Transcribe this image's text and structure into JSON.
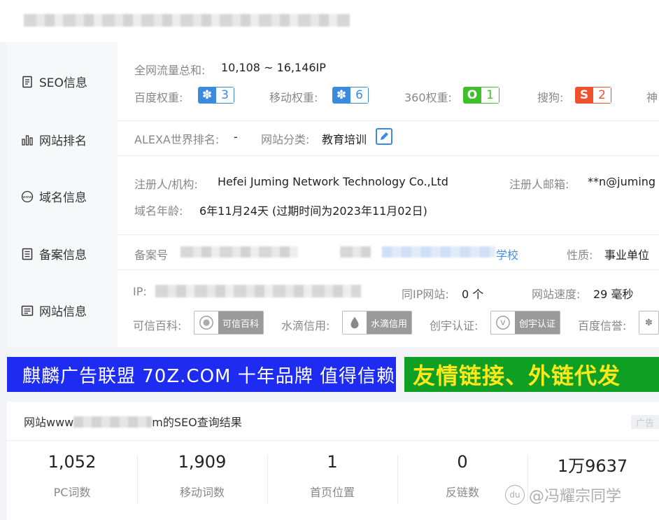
{
  "sidebar": {
    "items": [
      {
        "label": "SEO信息",
        "icon": "document-icon"
      },
      {
        "label": "网站排名",
        "icon": "bar-chart-icon"
      },
      {
        "label": "域名信息",
        "icon": "www-icon"
      },
      {
        "label": "备案信息",
        "icon": "record-icon"
      },
      {
        "label": "网站信息",
        "icon": "list-icon"
      }
    ]
  },
  "seo": {
    "traffic_label": "全网流量总和:",
    "traffic_value": "10,108 ~ 16,146IP",
    "baidu_label": "百度权重:",
    "baidu_value": "3",
    "mobile_label": "移动权重:",
    "mobile_value": "6",
    "s360_label": "360权重:",
    "s360_value": "1",
    "sogou_label": "搜狗:",
    "sogou_value": "2",
    "shenma_label": "神"
  },
  "rank": {
    "alexa_label": "ALEXA世界排名:",
    "alexa_value": "-",
    "category_label": "网站分类:",
    "category_value": "教育培训"
  },
  "domain": {
    "registrant_label": "注册人/机构:",
    "registrant_value": "Hefei Juming Network Technology Co.,Ltd",
    "email_label": "注册人邮箱:",
    "email_value": "**n@juming",
    "age_label": "域名年龄:",
    "age_value": "6年11月24天 (过期时间为2023年11月02日)"
  },
  "record": {
    "number_label": "备案号",
    "school_suffix": "学校",
    "nature_label": "性质:",
    "nature_value": "事业单位"
  },
  "site": {
    "ip_label": "IP:",
    "same_ip_label": "同IP网站:",
    "same_ip_value": "0 个",
    "speed_label": "网站速度:",
    "speed_value": "29 毫秒",
    "kexin_label": "可信百科:",
    "kexin_badge": "可信百科",
    "shuidi_label": "水滴信用:",
    "shuidi_badge": "水滴信用",
    "chuangyu_label": "创宇认证:",
    "chuangyu_badge": "创宇认证",
    "baidu_xinyu_label": "百度信誉:"
  },
  "banners": {
    "left": "麒麟广告联盟 70Z.COM 十年品牌 值得信赖",
    "right": "友情链接、外链代发",
    "ad_tag": "广告"
  },
  "result": {
    "title_prefix": "网站www",
    "title_suffix": "m的SEO查询结果",
    "stats": [
      {
        "value": "1,052",
        "label": "PC词数"
      },
      {
        "value": "1,909",
        "label": "移动词数"
      },
      {
        "value": "1",
        "label": "首页位置"
      },
      {
        "value": "0",
        "label": "反链数"
      },
      {
        "value": "1万9637",
        "label": ""
      }
    ]
  },
  "watermark": {
    "text": "@冯耀宗同学",
    "logo": "du"
  },
  "colors": {
    "baidu_blue": "#3a8be0",
    "s360_green": "#3fbf2c",
    "sogou_red": "#f0502d",
    "banner_blue": "#1d2cf0",
    "banner_green": "#0f9f23",
    "banner_yellow": "#ffe81a"
  }
}
